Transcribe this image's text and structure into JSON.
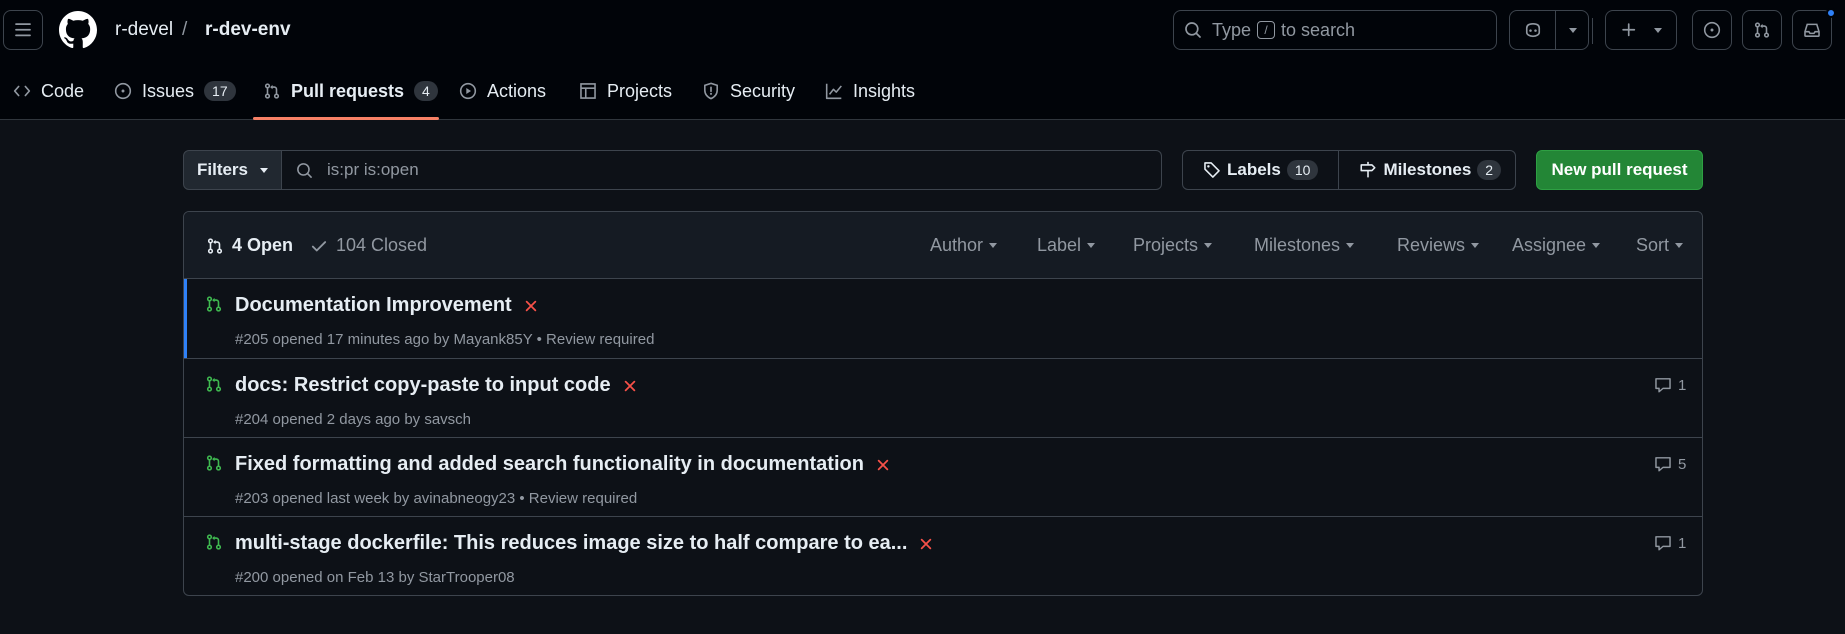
{
  "header": {
    "owner": "r-devel",
    "separator": "/",
    "repo": "r-dev-env",
    "search": {
      "before_key": "Type",
      "key": "/",
      "after_key": "to search"
    }
  },
  "tabs": [
    {
      "label": "Code",
      "icon": "code-icon"
    },
    {
      "label": "Issues",
      "icon": "issue-opened-icon",
      "count": "17"
    },
    {
      "label": "Pull requests",
      "icon": "git-pull-request-icon",
      "count": "4",
      "selected": true
    },
    {
      "label": "Actions",
      "icon": "play-icon"
    },
    {
      "label": "Projects",
      "icon": "table-icon"
    },
    {
      "label": "Security",
      "icon": "shield-icon"
    },
    {
      "label": "Insights",
      "icon": "graph-icon"
    }
  ],
  "toolbar": {
    "filters_label": "Filters",
    "filter_query": "is:pr is:open",
    "labels_label": "Labels",
    "labels_count": "10",
    "milestones_label": "Milestones",
    "milestones_count": "2",
    "new_pr_label": "New pull request"
  },
  "list": {
    "open_label": "4 Open",
    "closed_label": "104 Closed",
    "selectors": [
      "Author",
      "Label",
      "Projects",
      "Milestones",
      "Reviews",
      "Assignee",
      "Sort"
    ],
    "pulls": [
      {
        "title": "Documentation Improvement",
        "meta": "#205 opened 17 minutes ago by Mayank85Y • Review required",
        "comments": ""
      },
      {
        "title": "docs: Restrict copy-paste to input code",
        "meta": "#204 opened 2 days ago by savsch",
        "comments": "1"
      },
      {
        "title": "Fixed formatting and added search functionality in documentation",
        "meta": "#203 opened last week by avinabneogy23 • Review required",
        "comments": "5"
      },
      {
        "title": "multi-stage dockerfile: This reduces image size to half compare to ea...",
        "meta": "#200 opened on Feb 13 by StarTrooper08",
        "comments": "1"
      }
    ]
  },
  "colors": {
    "background": "#0d1117",
    "header_bg": "#010409",
    "border": "#3d444d",
    "open_green": "#3fb950",
    "fail_red": "#f85149",
    "tab_underline": "#f78166",
    "primary_button": "#238636",
    "notification_dot": "#2f81f7"
  }
}
